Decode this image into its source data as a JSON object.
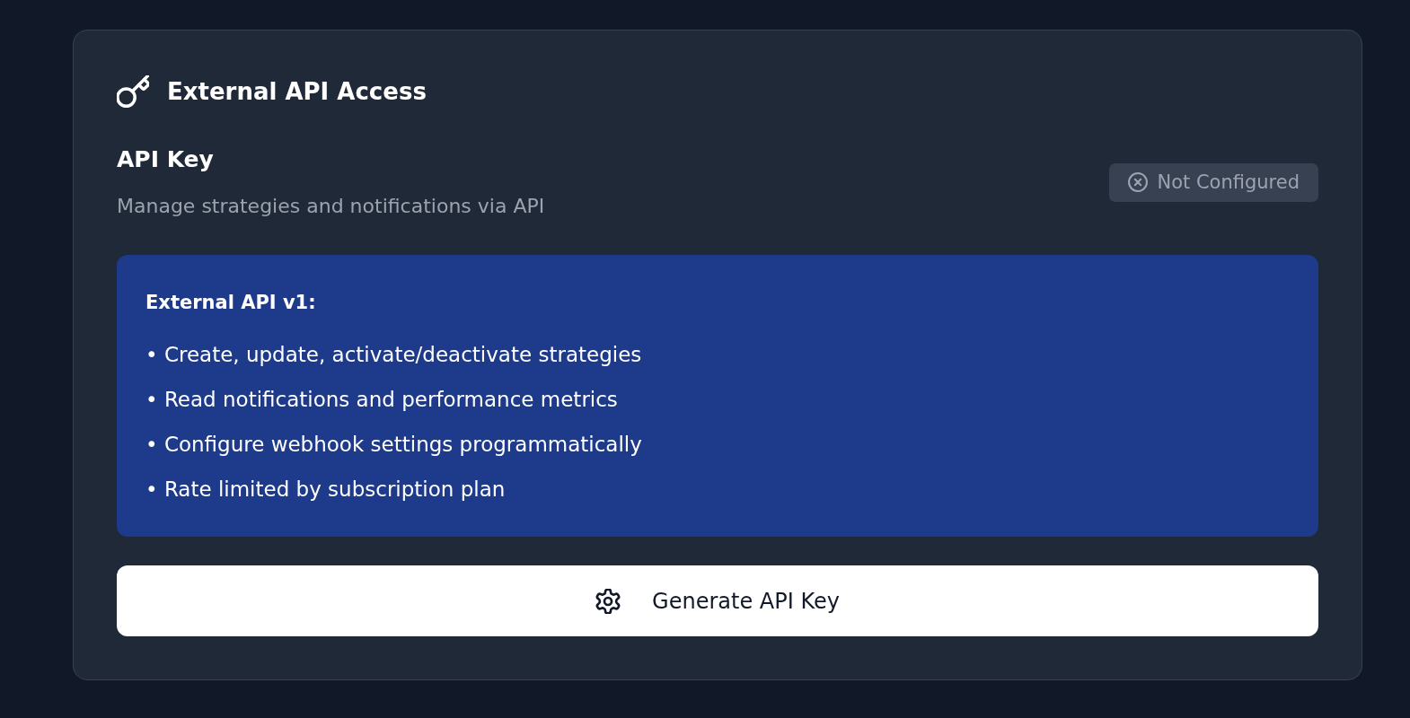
{
  "card": {
    "title": "External API Access"
  },
  "api_key": {
    "title": "API Key",
    "description": "Manage strategies and notifications via API",
    "status": {
      "label": "Not Configured"
    }
  },
  "info": {
    "heading": "External API v1:",
    "items": [
      "• Create, update, activate/deactivate strategies",
      "• Read notifications and performance metrics",
      "• Configure webhook settings programmatically",
      "• Rate limited by subscription plan"
    ]
  },
  "button": {
    "label": "Generate API Key"
  }
}
